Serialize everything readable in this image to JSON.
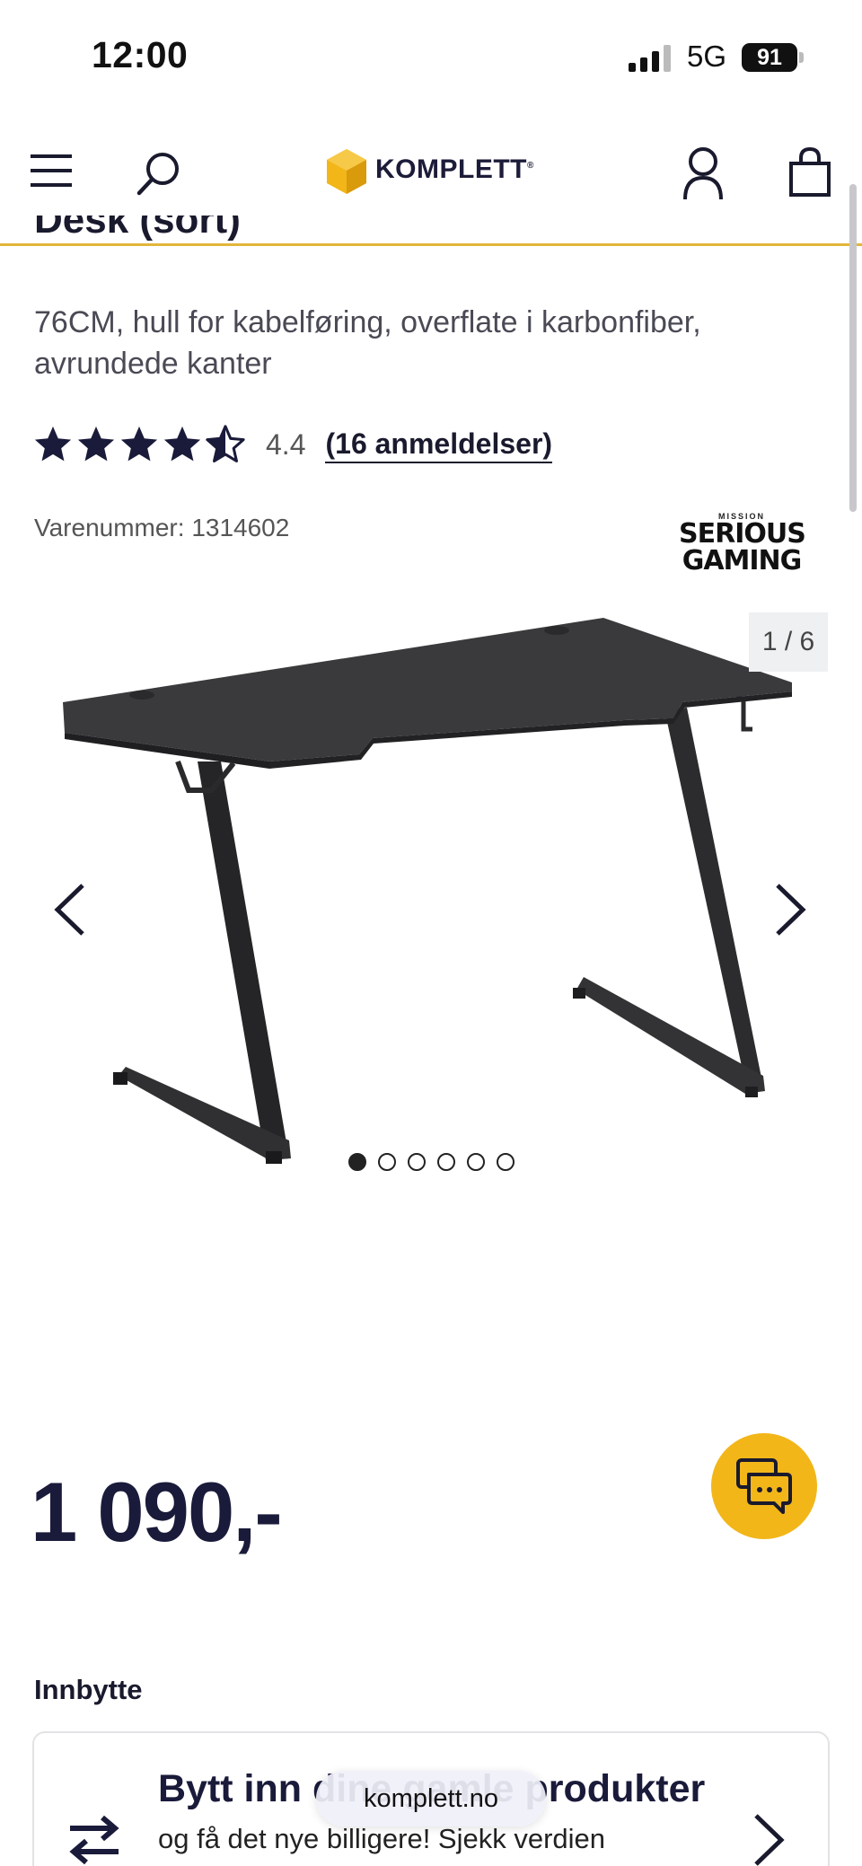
{
  "status_bar": {
    "time": "12:00",
    "network": "5G",
    "battery": "91"
  },
  "header": {
    "logo_text": "KOMPLETT",
    "logo_mark": "®"
  },
  "product": {
    "title_partial": "Desk (sort)",
    "subtitle": "76CM, hull for kabelføring, overflate i karbonfiber, avrundede kanter",
    "rating": 4.4,
    "rating_text": "4.4",
    "reviews_link": "(16 anmeldelser)",
    "sku": "Varenummer: 1314602",
    "brand_small": "MISSION",
    "brand_line1": "SERIOUS",
    "brand_line2": "GAMING"
  },
  "gallery": {
    "counter": "1 / 6",
    "dot_count": 6,
    "active_dot": 0
  },
  "price": "1 090,-",
  "trade_in": {
    "label": "Innbytte",
    "title": "Bytt inn dine gamle produkter",
    "subtitle": "og få det nye billigere! Sjekk verdien"
  },
  "browser": {
    "url": "komplett.no"
  },
  "colors": {
    "accent": "#f2b619",
    "navy": "#1a1a3a",
    "divider": "#e2b63a"
  }
}
